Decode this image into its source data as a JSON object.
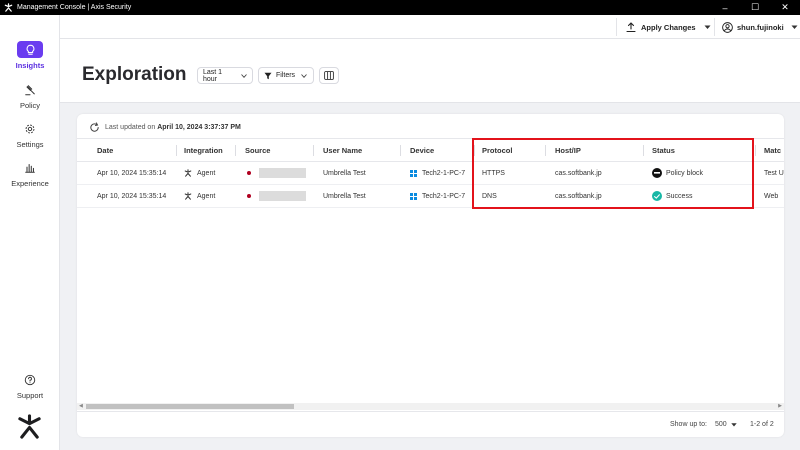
{
  "window": {
    "title": "Management Console | Axis Security",
    "minimize": "–",
    "maximize": "☐",
    "close": "✕"
  },
  "sidebar": {
    "items": [
      {
        "label": "Insights",
        "icon": "lightbulb-icon",
        "active": true
      },
      {
        "label": "Policy",
        "icon": "gavel-icon",
        "active": false
      },
      {
        "label": "Settings",
        "icon": "gear-icon",
        "active": false
      },
      {
        "label": "Experience",
        "icon": "bar-chart-icon",
        "active": false
      }
    ],
    "support": "Support"
  },
  "header": {
    "apply_changes": "Apply Changes",
    "username": "shun.fujinoki"
  },
  "page": {
    "title": "Exploration",
    "time_filter": "Last 1 hour",
    "filters": "Filters"
  },
  "card": {
    "updated_prefix": "Last updated on",
    "updated_time": "April 10, 2024 3:37:37 PM",
    "columns": [
      "Date",
      "Integration",
      "Source",
      "User Name",
      "Device",
      "Protocol",
      "Host/IP",
      "Status",
      "Matc"
    ],
    "rows": [
      {
        "date": "Apr 10, 2024  15:35:14",
        "integration": "Agent",
        "user": "Umbrella Test",
        "device": "Tech2-1-PC-7",
        "protocol": "HTTPS",
        "host": "cas.softbank.jp",
        "status": "Policy block",
        "status_color": "#111111",
        "match": "Test U"
      },
      {
        "date": "Apr 10, 2024  15:35:14",
        "integration": "Agent",
        "user": "Umbrella Test",
        "device": "Tech2-1-PC-7",
        "protocol": "DNS",
        "host": "cas.softbank.jp",
        "status": "Success",
        "status_color": "#18b8a6",
        "match": "Web"
      }
    ],
    "footer": {
      "show_label": "Show up to:",
      "page_size": "500",
      "count": "1-2 of 2"
    }
  },
  "colors": {
    "accent": "#6a3cf0",
    "highlight": "#e3131b",
    "source_dot": "#b00020",
    "windows": "#0a8be0"
  }
}
